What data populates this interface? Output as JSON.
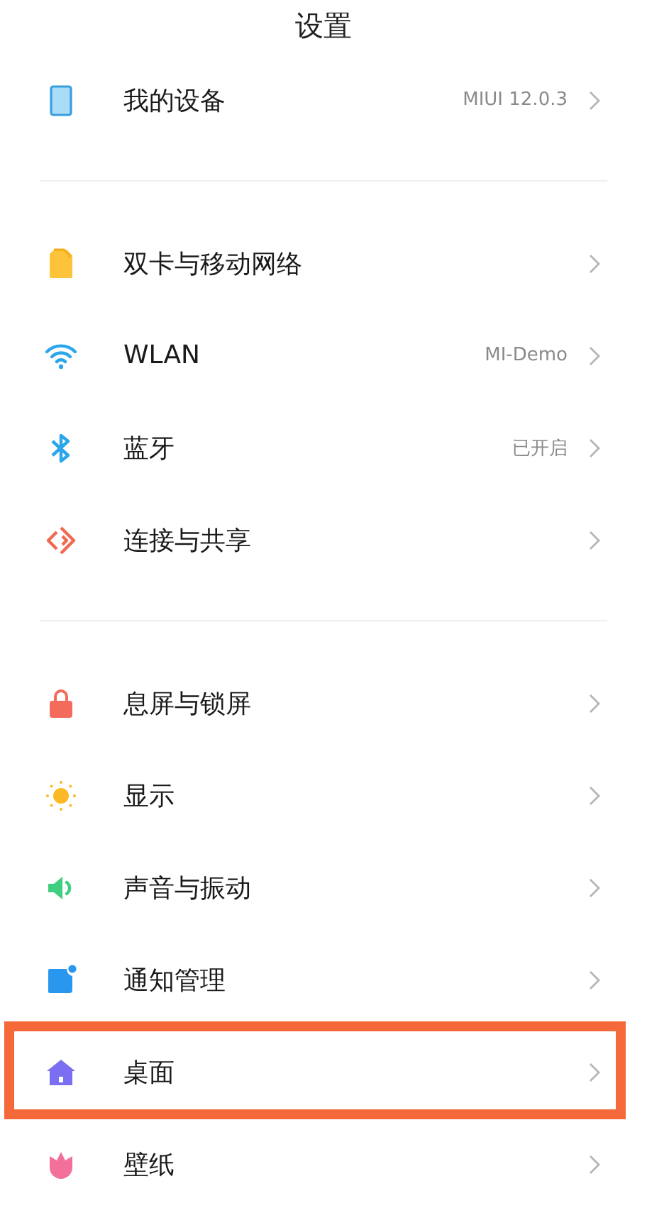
{
  "header": {
    "title": "设置"
  },
  "groups": [
    {
      "items": [
        {
          "label": "我的设备",
          "value": "MIUI 12.0.3",
          "highlighted": false
        }
      ]
    },
    {
      "items": [
        {
          "label": "双卡与移动网络",
          "highlighted": false
        },
        {
          "label": "WLAN",
          "value": "MI-Demo",
          "highlighted": false
        },
        {
          "label": "蓝牙",
          "value": "已开启",
          "highlighted": false
        },
        {
          "label": "连接与共享",
          "highlighted": false
        }
      ]
    },
    {
      "items": [
        {
          "label": "息屏与锁屏",
          "highlighted": false
        },
        {
          "label": "显示",
          "highlighted": false
        },
        {
          "label": "声音与振动",
          "highlighted": false
        },
        {
          "label": "通知管理",
          "highlighted": false
        },
        {
          "label": "桌面",
          "highlighted": true
        },
        {
          "label": "壁纸",
          "highlighted": false
        }
      ]
    }
  ]
}
